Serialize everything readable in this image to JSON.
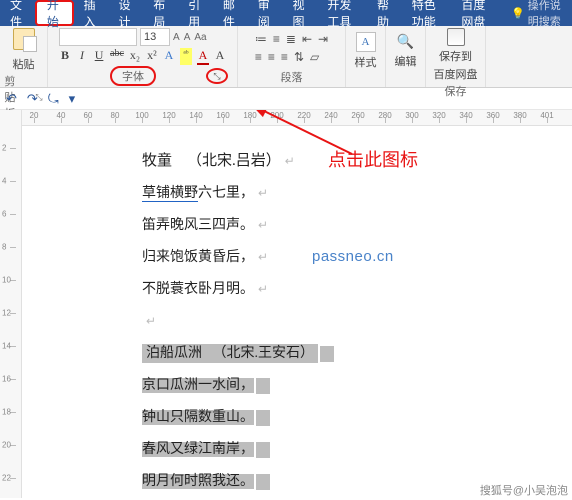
{
  "menu": {
    "file": "文件",
    "tabs": [
      "开始",
      "插入",
      "设计",
      "布局",
      "引用",
      "邮件",
      "审阅",
      "视图",
      "开发工具",
      "帮助",
      "特色功能",
      "百度网盘"
    ],
    "tell_me": "操作说明搜索"
  },
  "ribbon": {
    "clipboard": {
      "paste": "粘贴",
      "label": "剪贴板"
    },
    "font": {
      "size": "13",
      "label": "字体",
      "btns": [
        "B",
        "I",
        "U",
        "abc",
        "x₂",
        "x²",
        "A",
        "ᵃᵇ",
        "A",
        "A"
      ]
    },
    "paragraph": {
      "label": "段落"
    },
    "styles": {
      "glyph": "A",
      "label": "样式"
    },
    "editing": {
      "label": "编辑"
    },
    "save": {
      "line1": "保存到",
      "line2": "百度网盘",
      "label": "保存"
    }
  },
  "qat": [
    "↶",
    "↷",
    "⤿",
    "▾"
  ],
  "hruler_nums": [
    20,
    40,
    60,
    80,
    100,
    120,
    140,
    160,
    180,
    200,
    220,
    240,
    260,
    280,
    300,
    320,
    340,
    360,
    380,
    401
  ],
  "vruler_nums": [
    "2",
    "4",
    "6",
    "8",
    "10",
    "12",
    "14",
    "16",
    "18",
    "20",
    "22"
  ],
  "doc": {
    "poem1": {
      "title_a": "牧童",
      "title_b": "（北宋.吕岩）",
      "l1a": "草铺横野",
      "l1b": "六七里，",
      "l1u": true,
      "l2": "笛弄晚风三四声。",
      "l3": "归来饱饭黄昏后，",
      "l4": "不脱蓑衣卧月明。"
    },
    "poem2": {
      "title_a": "泊船瓜洲",
      "title_b": "（北宋.王安石）",
      "l1": "京口瓜洲一水间，",
      "l2": "钟山只隔数重山。",
      "l3": "春风又绿江南岸，",
      "l4": "明月何时照我还。"
    }
  },
  "callout": "点击此图标",
  "watermark": "passneo.cn",
  "attribution": "搜狐号@小吴泡泡"
}
